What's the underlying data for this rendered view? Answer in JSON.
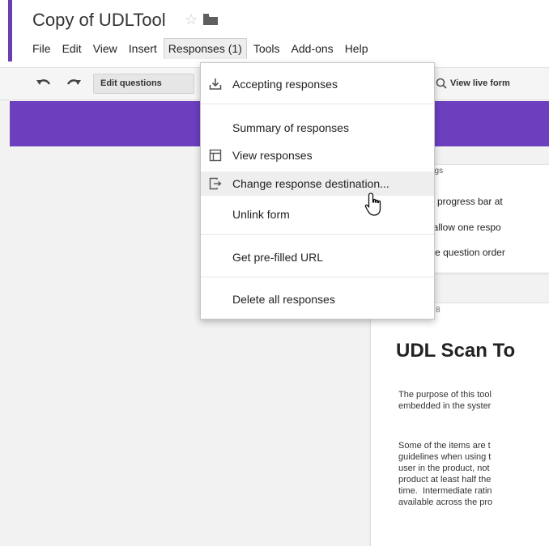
{
  "header": {
    "doc_title": "Copy of UDLTool",
    "star_icon": "star-icon",
    "folder_icon": "folder-icon",
    "accent_color": "#6a3fb3"
  },
  "menubar": {
    "items": [
      {
        "label": "File"
      },
      {
        "label": "Edit"
      },
      {
        "label": "View"
      },
      {
        "label": "Insert"
      },
      {
        "label": "Responses (1)"
      },
      {
        "label": "Tools"
      },
      {
        "label": "Add-ons"
      },
      {
        "label": "Help"
      }
    ]
  },
  "toolbar": {
    "undo_icon": "undo-icon",
    "redo_icon": "redo-icon",
    "edit_questions_label": "Edit questions",
    "view_live_form_label": "View live form"
  },
  "theme": {
    "band_color": "#6b3fbe"
  },
  "responses_menu": {
    "accepting": "Accepting responses",
    "summary": "Summary of responses",
    "view": "View responses",
    "change_destination": "Change response destination...",
    "unlink": "Unlink form",
    "prefilled": "Get pre-filled URL",
    "delete_all": "Delete all responses"
  },
  "settings_panel": {
    "tab_label": "tings",
    "rows": [
      "w progress bar at",
      "/ allow one respo",
      "ffle question order"
    ]
  },
  "form_preview": {
    "tab_label": "8",
    "title": "UDL Scan To",
    "paragraph1": "The purpose of this tool\nembedded in the syster",
    "paragraph2": "Some of the items are t\nguidelines when using t\nuser in the product, not\nproduct at least half the\ntime.  Intermediate ratin\navailable across the pro"
  }
}
